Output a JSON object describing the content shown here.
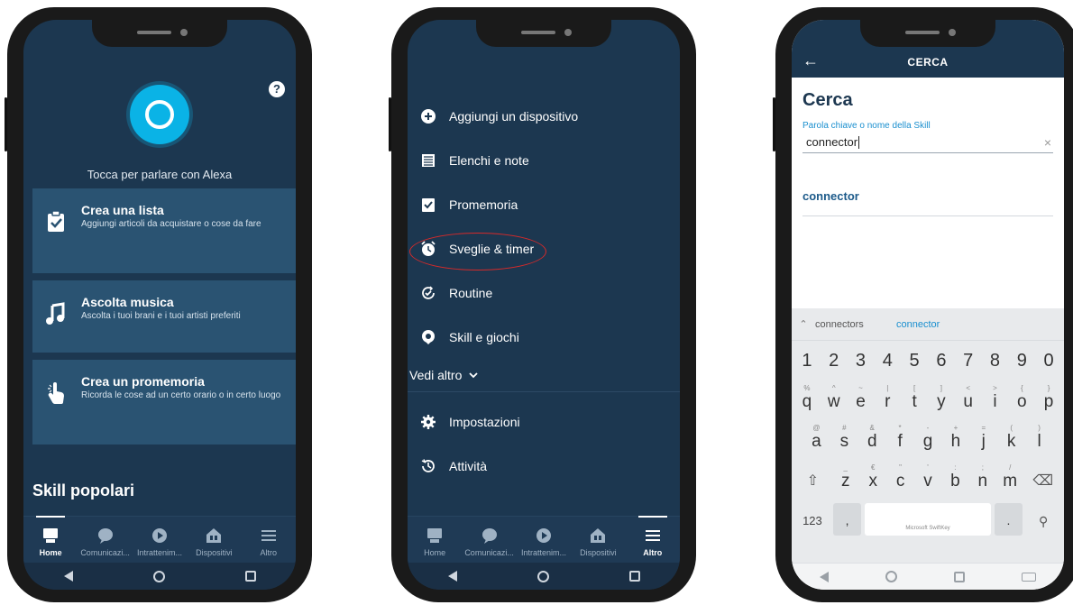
{
  "phone1": {
    "help_label": "?",
    "tap_label": "Tocca per parlare con Alexa",
    "cards": [
      {
        "title": "Crea una lista",
        "subtitle": "Aggiungi articoli da acquistare o cose da fare"
      },
      {
        "title": "Ascolta musica",
        "subtitle": "Ascolta i tuoi brani e i tuoi artisti preferiti"
      },
      {
        "title": "Crea un promemoria",
        "subtitle": "Ricorda le cose ad un certo orario o in certo luogo"
      }
    ],
    "section_title": "Skill popolari"
  },
  "tabbar": {
    "items": [
      {
        "label": "Home",
        "icon": "home-icon"
      },
      {
        "label": "Comunicazi...",
        "icon": "chat-bubble-icon"
      },
      {
        "label": "Intrattenim...",
        "icon": "play-icon"
      },
      {
        "label": "Dispositivi",
        "icon": "devices-house-icon"
      },
      {
        "label": "Altro",
        "icon": "hamburger-menu-icon"
      }
    ]
  },
  "phone2": {
    "menu_items": [
      {
        "label": "Aggiungi un dispositivo",
        "icon": "plus-circle-icon"
      },
      {
        "label": "Elenchi e note",
        "icon": "list-icon"
      },
      {
        "label": "Promemoria",
        "icon": "clipboard-check-icon"
      },
      {
        "label": "Sveglie & timer",
        "icon": "alarm-clock-icon"
      },
      {
        "label": "Routine",
        "icon": "routine-check-icon"
      },
      {
        "label": "Skill e giochi",
        "icon": "skill-badge-icon"
      }
    ],
    "see_more": "Vedi altro",
    "bottom_items": [
      {
        "label": "Impostazioni",
        "icon": "gear-icon"
      },
      {
        "label": "Attività",
        "icon": "history-clock-icon"
      }
    ],
    "highlight_color": "#d62a2a"
  },
  "phone3": {
    "header_title": "CERCA",
    "page_title": "Cerca",
    "input_label": "Parola chiave o nome della Skill",
    "input_value": "connector",
    "result": "connector",
    "suggestions": [
      "connectors",
      "connector"
    ],
    "keyboard": {
      "numbers": [
        "1",
        "2",
        "3",
        "4",
        "5",
        "6",
        "7",
        "8",
        "9",
        "0"
      ],
      "row1": [
        [
          "q",
          "%"
        ],
        [
          "w",
          "^"
        ],
        [
          "e",
          "~"
        ],
        [
          "r",
          "|"
        ],
        [
          "t",
          "["
        ],
        [
          "y",
          "]"
        ],
        [
          "u",
          "<"
        ],
        [
          "i",
          ">"
        ],
        [
          "o",
          "{"
        ],
        [
          "p",
          "}"
        ]
      ],
      "row2": [
        [
          "a",
          "@"
        ],
        [
          "s",
          "#"
        ],
        [
          "d",
          "&"
        ],
        [
          "f",
          "*"
        ],
        [
          "g",
          "-"
        ],
        [
          "h",
          "+"
        ],
        [
          "j",
          "="
        ],
        [
          "k",
          "("
        ],
        [
          "l",
          ")"
        ]
      ],
      "row3": [
        [
          "z",
          "_"
        ],
        [
          "x",
          "€"
        ],
        [
          "c",
          "\""
        ],
        [
          "v",
          "'"
        ],
        [
          "b",
          ":"
        ],
        [
          "n",
          ";"
        ],
        [
          "m",
          "/"
        ]
      ],
      "key_123": "123",
      "key_comma": ",",
      "key_dot": ".",
      "space_label": "Microsoft SwiftKey"
    }
  },
  "colors": {
    "app_dark": "#1c3750",
    "card": "#2a5372",
    "alexa_cyan": "#0ab3e6",
    "link_blue": "#1a8fcf"
  }
}
